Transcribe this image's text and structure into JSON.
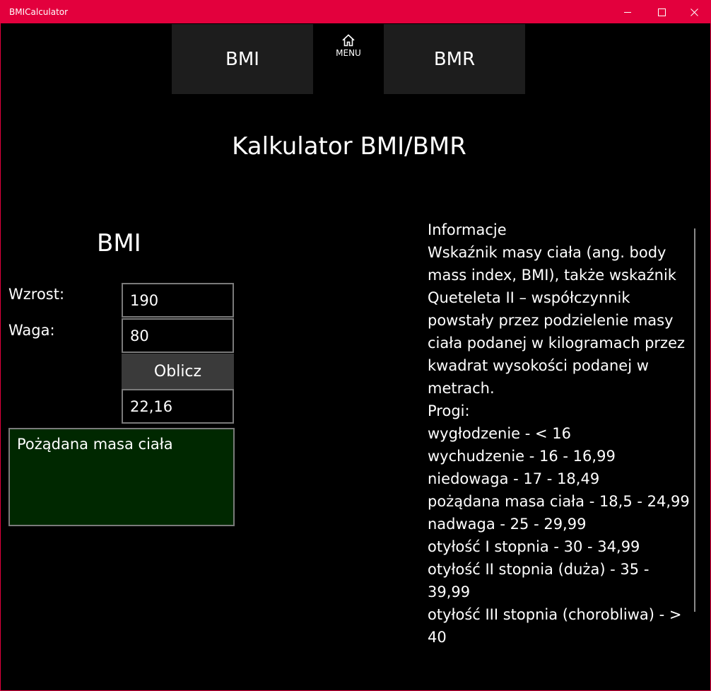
{
  "window": {
    "title": "BMICalculator"
  },
  "nav": {
    "bmi_label": "BMI",
    "menu_label": "MENU",
    "bmr_label": "BMR"
  },
  "page": {
    "title": "Kalkulator BMI/BMR"
  },
  "bmi_form": {
    "section_title": "BMI",
    "height_label": "Wzrost:",
    "height_value": "190",
    "weight_label": "Waga:",
    "weight_value": "80",
    "calculate_label": "Oblicz",
    "result_value": "22,16",
    "result_category": "Pożądana masa ciała"
  },
  "info": {
    "lines": [
      "Informacje",
      "Wskaźnik masy ciała (ang. body mass index, BMI), także wskaźnik Queteleta II – współczynnik powstały przez podzielenie masy ciała podanej w kilogramach przez kwadrat wysokości podanej w metrach.",
      "Progi:",
      "wygłodzenie - < 16",
      "wychudzenie - 16 - 16,99",
      "niedowaga - 17 - 18,49",
      "pożądana masa ciała - 18,5 - 24,99",
      "nadwaga - 25 - 29,99",
      "otyłość I stopnia - 30 - 34,99",
      "otyłość II stopnia (duża) - 35 - 39,99",
      "otyłość III stopnia (chorobliwa) - > 40"
    ]
  },
  "colors": {
    "titlebar": "#e3003d",
    "nav_button": "#1d1d1d",
    "calc_button": "#3a3a3a",
    "result_box": "#002800"
  }
}
